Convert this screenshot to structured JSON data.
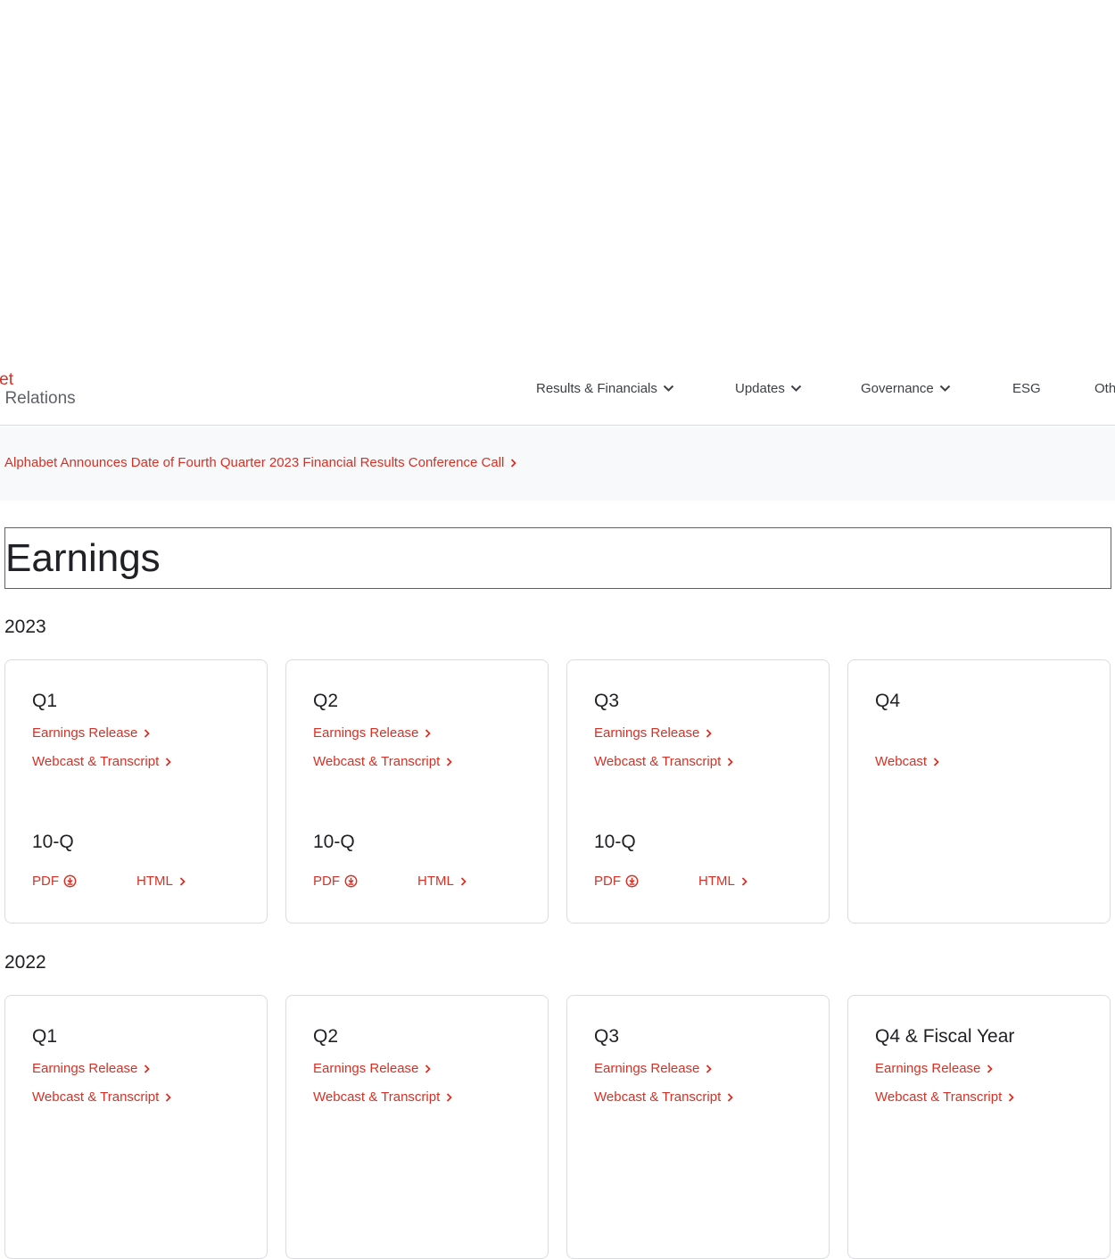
{
  "header": {
    "logo_top": "abet",
    "logo_bottom": "tor Relations",
    "nav": [
      {
        "label": "Results & Financials"
      },
      {
        "label": "Updates"
      },
      {
        "label": "Governance"
      },
      {
        "label": "ESG"
      },
      {
        "label": "Oth"
      }
    ]
  },
  "banner": {
    "link": "Alphabet Announces Date of Fourth Quarter 2023 Financial Results Conference Call"
  },
  "page": {
    "title": "Earnings"
  },
  "years": [
    {
      "year": "2023",
      "cards": [
        {
          "quarter": "Q1",
          "earnings": "Earnings Release",
          "webcast": "Webcast & Transcript",
          "tenq": "10-Q",
          "pdf": "PDF",
          "html": "HTML"
        },
        {
          "quarter": "Q2",
          "earnings": "Earnings Release",
          "webcast": "Webcast & Transcript",
          "tenq": "10-Q",
          "pdf": "PDF",
          "html": "HTML"
        },
        {
          "quarter": "Q3",
          "earnings": "Earnings Release",
          "webcast": "Webcast & Transcript",
          "tenq": "10-Q",
          "pdf": "PDF",
          "html": "HTML"
        },
        {
          "quarter": "Q4",
          "webcast": "Webcast"
        }
      ]
    },
    {
      "year": "2022",
      "cards": [
        {
          "quarter": "Q1",
          "earnings": "Earnings Release",
          "webcast": "Webcast & Transcript"
        },
        {
          "quarter": "Q2",
          "earnings": "Earnings Release",
          "webcast": "Webcast & Transcript"
        },
        {
          "quarter": "Q3",
          "earnings": "Earnings Release",
          "webcast": "Webcast & Transcript"
        },
        {
          "quarter": "Q4 & Fiscal Year",
          "earnings": "Earnings Release",
          "webcast": "Webcast & Transcript"
        }
      ]
    }
  ],
  "colors": {
    "accent": "#d93025",
    "text": "#202124",
    "border": "#dadce0",
    "banner_bg": "#f8f9fa"
  }
}
